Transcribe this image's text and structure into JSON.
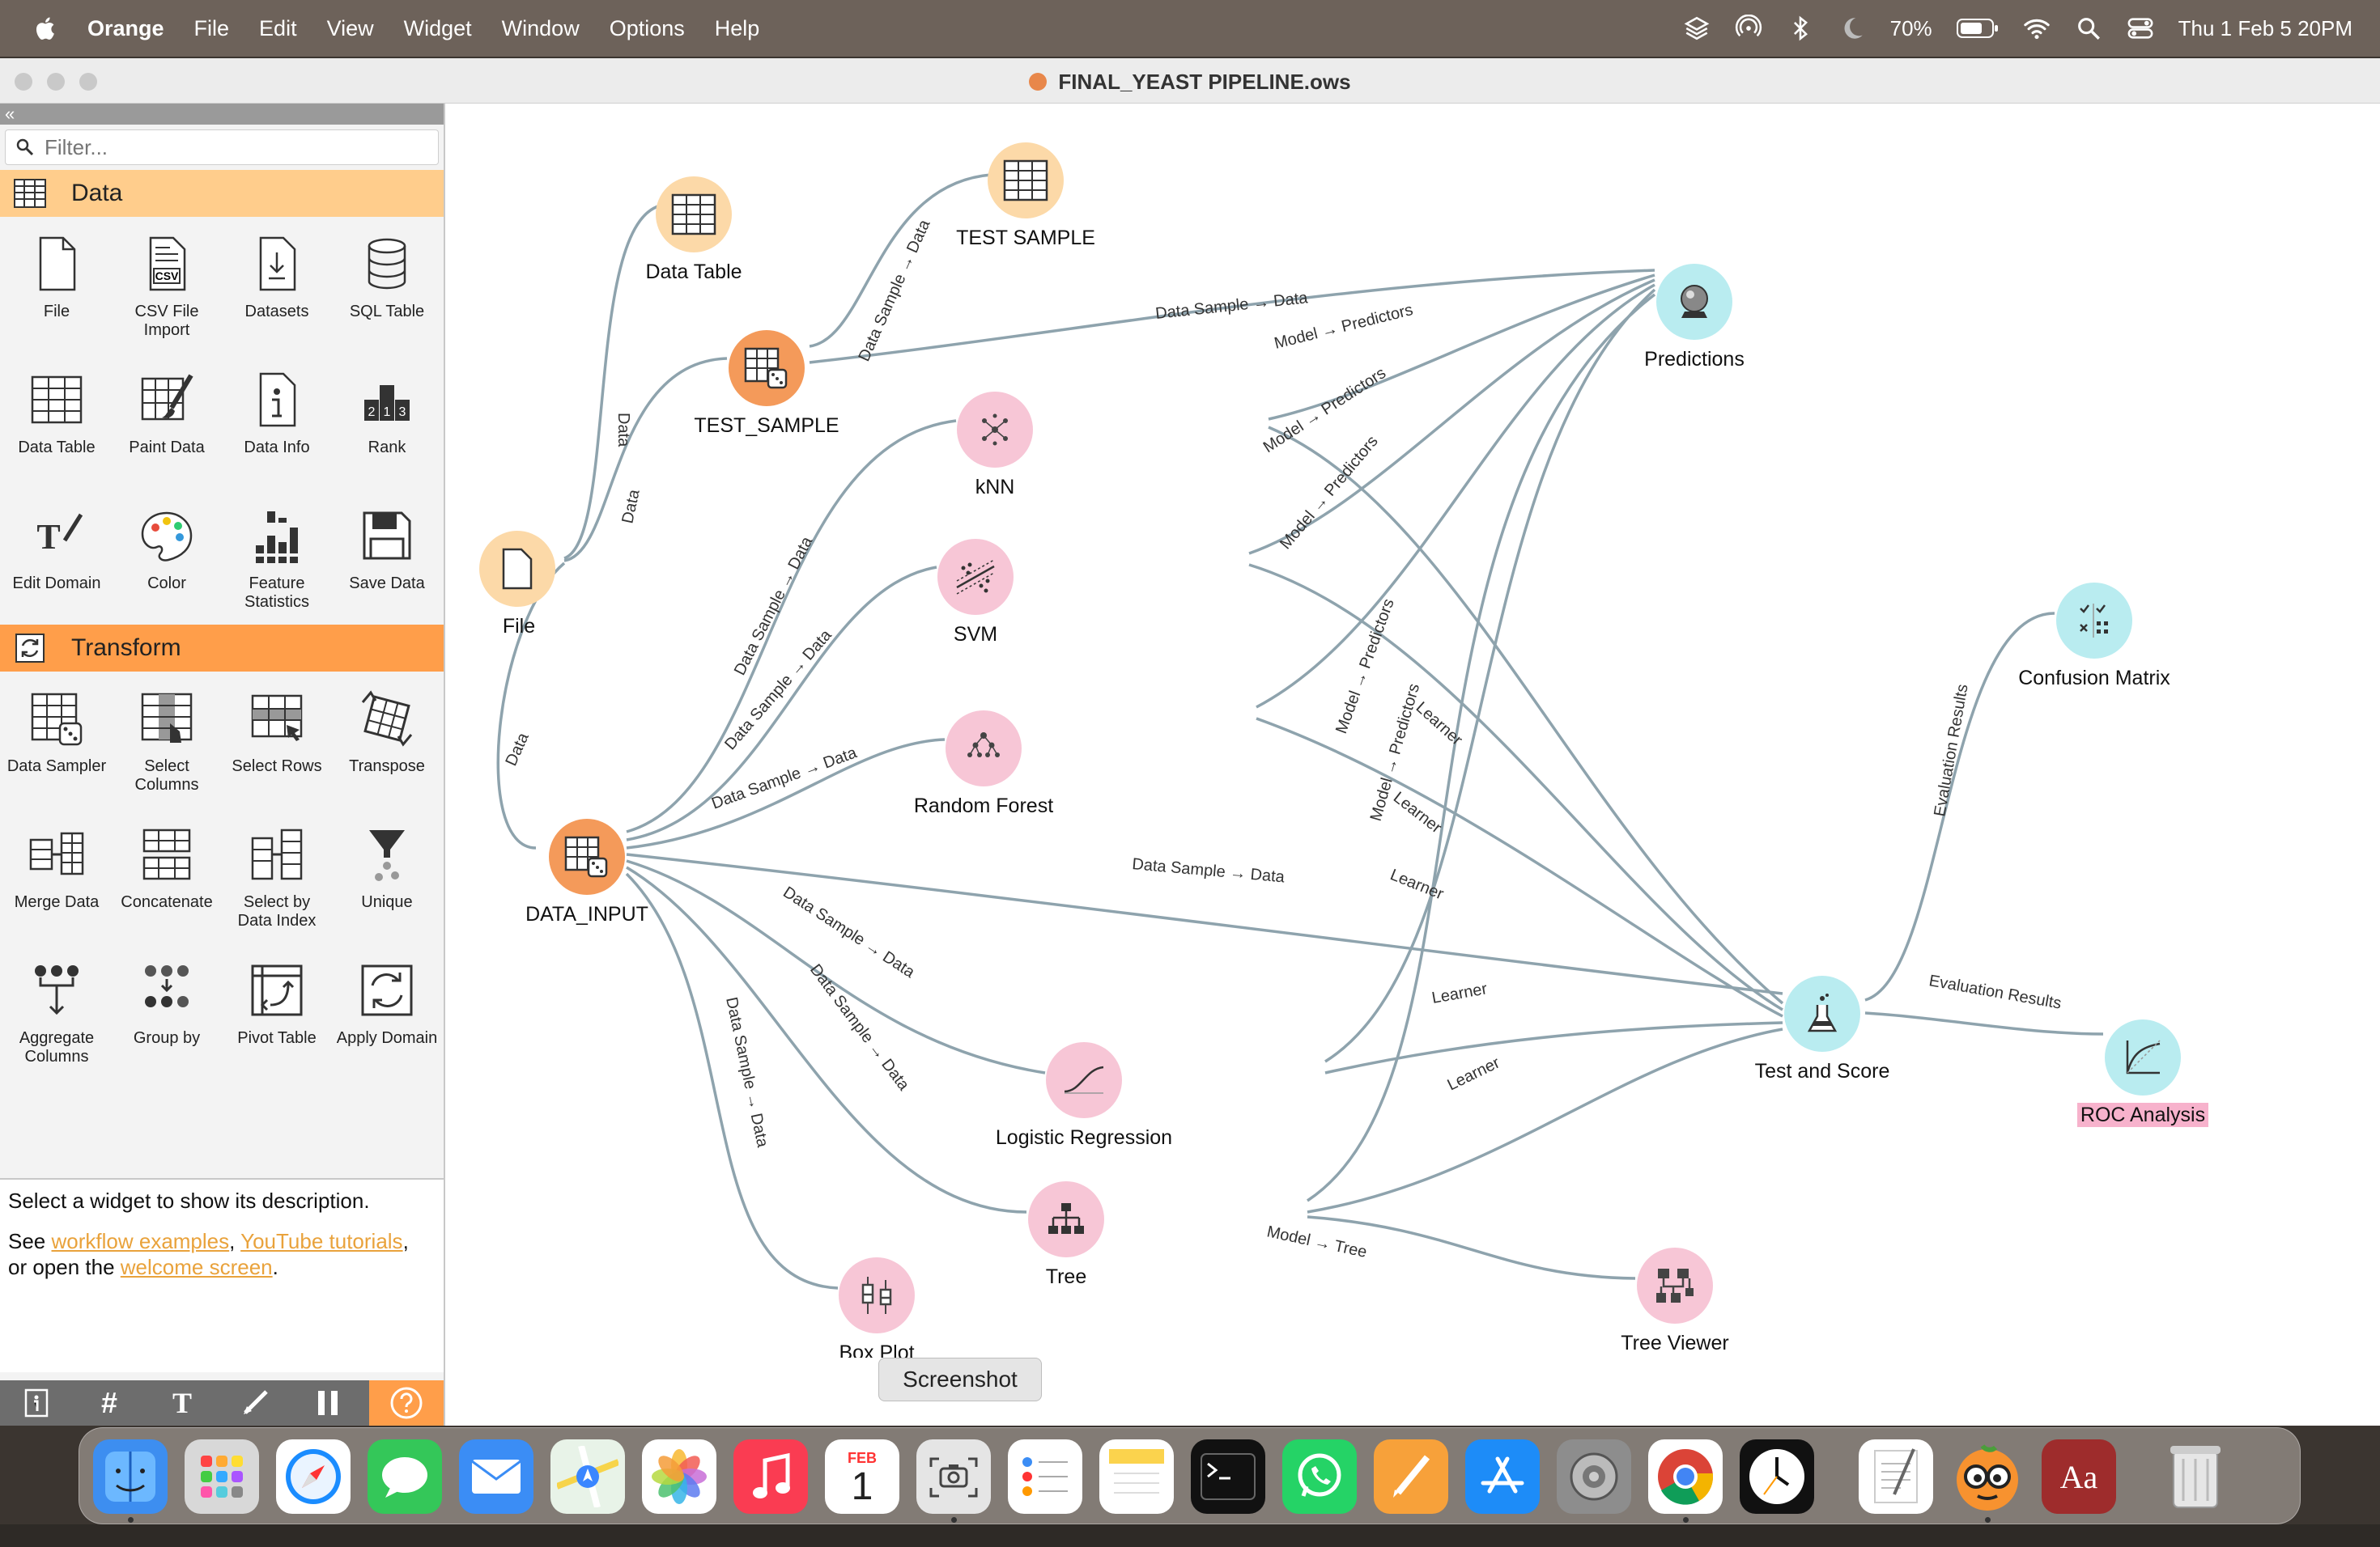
{
  "menubar": {
    "app_name": "Orange",
    "items": [
      "File",
      "Edit",
      "View",
      "Widget",
      "Window",
      "Options",
      "Help"
    ],
    "battery": "70%",
    "clock": "Thu 1 Feb  5 20PM"
  },
  "window": {
    "title": "FINAL_YEAST PIPELINE.ows"
  },
  "toolbox": {
    "collapse": "«",
    "filter_placeholder": "Filter...",
    "categories": [
      {
        "name": "Data",
        "color": "#ffcd8c",
        "widgets": [
          "File",
          "CSV File Import",
          "Datasets",
          "SQL Table",
          "Data Table",
          "Paint Data",
          "Data Info",
          "Rank",
          "Edit Domain",
          "Color",
          "Feature Statistics",
          "Save Data"
        ]
      },
      {
        "name": "Transform",
        "color": "#ff9e4a",
        "widgets": [
          "Data Sampler",
          "Select Columns",
          "Select Rows",
          "Transpose",
          "Merge Data",
          "Concatenate",
          "Select by Data Index",
          "Unique",
          "Aggregate Columns",
          "Group by",
          "Pivot Table",
          "Apply Domain"
        ]
      }
    ],
    "description": {
      "line1": "Select a widget to show its description.",
      "see": "See ",
      "link1": "workflow examples",
      "comma": ", ",
      "link2": "YouTube tutorials",
      "trail": ",",
      "or_open": "or open the ",
      "link3": "welcome screen",
      "dot": "."
    }
  },
  "canvas": {
    "nodes": {
      "file": "File",
      "data_table": "Data Table",
      "test_sample_top": "TEST SAMPLE",
      "test_sample": "TEST_SAMPLE",
      "predictions": "Predictions",
      "knn": "kNN",
      "svm": "SVM",
      "random_forest": "Random Forest",
      "data_input": "DATA_INPUT",
      "confusion_matrix": "Confusion Matrix",
      "test_and_score": "Test and Score",
      "roc_analysis": "ROC Analysis",
      "logistic_regression": "Logistic Regression",
      "tree": "Tree",
      "tree_viewer": "Tree Viewer",
      "box_plot": "Box Plot"
    },
    "link_labels": {
      "data": "Data",
      "data_sample_data": "Data Sample → Data",
      "model_predictors": "Model → Predictors",
      "learner": "Learner",
      "evaluation_results": "Evaluation Results",
      "model_tree": "Model → Tree"
    },
    "colors": {
      "data_widget": "#fcd9a8",
      "transform_widget": "#f49a5a",
      "model_widget": "#f7c6d6",
      "evaluate_widget": "#b9ecf0",
      "link": "#8ea3ad"
    }
  },
  "tooltip": "Screenshot",
  "dock": {
    "calendar_month": "FEB",
    "calendar_day": "1",
    "dictionary": "Aa"
  }
}
